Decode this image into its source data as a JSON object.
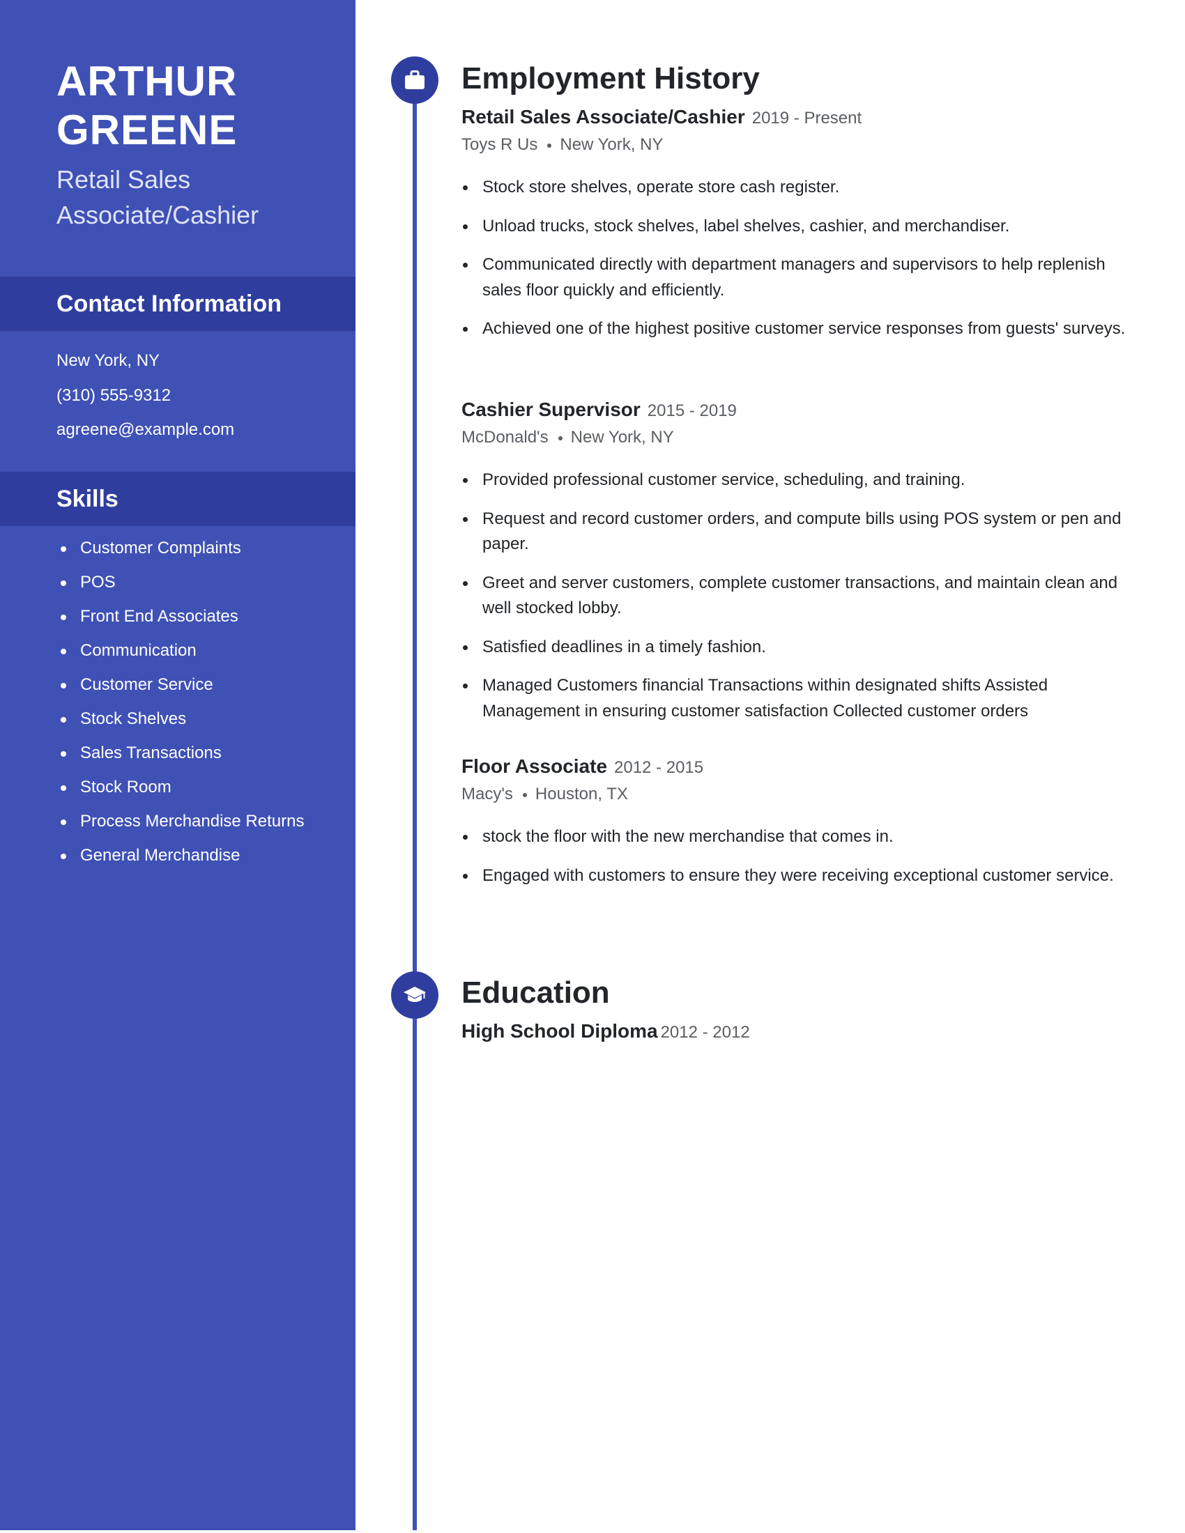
{
  "profile": {
    "first_name": "ARTHUR",
    "last_name": "GREENE",
    "title": "Retail Sales Associate/Cashier"
  },
  "sidebar": {
    "contact": {
      "heading": "Contact Information",
      "items": [
        "New York, NY",
        "(310) 555-9312",
        "agreene@example.com"
      ]
    },
    "skills": {
      "heading": "Skills",
      "items": [
        "Customer Complaints",
        "POS",
        "Front End Associates",
        "Communication",
        "Customer Service",
        "Stock Shelves",
        "Sales Transactions",
        "Stock Room",
        "Process Merchandise Returns",
        "General Merchandise"
      ]
    }
  },
  "employment": {
    "heading": "Employment History",
    "icon": "briefcase-icon",
    "jobs": [
      {
        "title": "Retail Sales Associate/Cashier",
        "dates": "2019 - Present",
        "company": "Toys R Us",
        "location": "New York, NY",
        "bullets": [
          "Stock store shelves, operate store cash register.",
          "Unload trucks, stock shelves, label shelves, cashier, and merchandiser.",
          "Communicated directly with department managers and supervisors to help replenish sales floor quickly and efficiently.",
          "Achieved one of the highest positive customer service responses from guests' surveys."
        ]
      },
      {
        "title": "Cashier Supervisor",
        "dates": "2015 - 2019",
        "company": "McDonald's",
        "location": "New York, NY",
        "bullets": [
          "Provided professional customer service, scheduling, and training.",
          "Request and record customer orders, and compute bills using POS system or pen and paper.",
          "Greet and server customers, complete customer transactions, and maintain clean and well stocked lobby.",
          "Satisfied deadlines in a timely fashion.",
          "Managed Customers financial Transactions within designated shifts Assisted Management in ensuring customer satisfaction Collected customer orders"
        ]
      },
      {
        "title": "Floor Associate",
        "dates": "2012 - 2015",
        "company": "Macy's",
        "location": "Houston, TX",
        "bullets": [
          "stock the floor with the new merchandise that comes in.",
          "Engaged with customers to ensure they were receiving exceptional customer service."
        ]
      }
    ]
  },
  "education": {
    "heading": "Education",
    "icon": "graduation-cap-icon",
    "entries": [
      {
        "degree": "High School Diploma",
        "dates": "2012 - 2012"
      }
    ]
  },
  "colors": {
    "sidebar": "#3f51b5",
    "sidebar_band": "#2f3e9e",
    "accent": "#3f51b5",
    "text": "#222529",
    "muted": "#5a5d63"
  }
}
